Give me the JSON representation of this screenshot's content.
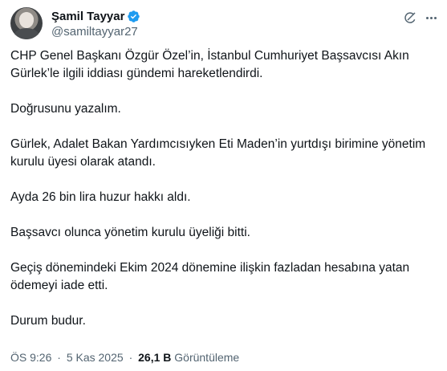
{
  "author": {
    "display_name": "Şamil Tayyar",
    "handle": "@samiltayyar27",
    "verified": true
  },
  "colors": {
    "verified_badge": "#1d9bf0",
    "text_primary": "#0f1419",
    "text_secondary": "#536471"
  },
  "icons": {
    "grok": "grok-icon",
    "more": "more-options-icon",
    "verified": "verified-badge-icon"
  },
  "paragraphs": [
    "CHP Genel Başkanı Özgür Özel’in, İstanbul Cumhuriyet Başsavcısı Akın Gürlek’le ilgili iddiası gündemi hareketlendirdi.",
    "Doğrusunu yazalım.",
    "Gürlek, Adalet Bakan Yardımcısıyken Eti Maden’in yurtdışı birimine yönetim kurulu üyesi olarak atandı.",
    "Ayda 26 bin lira huzur hakkı aldı.",
    "Başsavcı olunca yönetim kurulu üyeliği bitti.",
    "Geçiş dönemindeki Ekim 2024 dönemine ilişkin fazladan hesabına yatan ödemeyi iade etti.",
    "Durum budur."
  ],
  "meta": {
    "time": "ÖS 9:26",
    "separator": "·",
    "date": "5 Kas 2025",
    "views_count": "26,1 B",
    "views_label": "Görüntüleme"
  }
}
